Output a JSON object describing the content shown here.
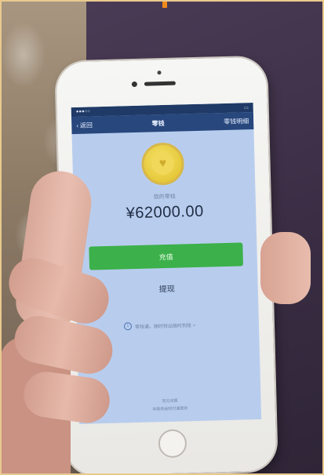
{
  "wallet_screen": {
    "nav": {
      "back_label": "返回",
      "title": "零钱",
      "right_label": "零钱明细"
    },
    "balance": {
      "label": "我的零钱",
      "amount": "¥62000.00"
    },
    "buttons": {
      "recharge_label": "充值",
      "withdraw_label": "提现"
    },
    "notice_text": "零钱通，随时转出随时到账 >",
    "footer_text": "常见问题",
    "footer_subtext": "本服务由财付通提供"
  },
  "colors": {
    "nav_bar": "#27477d",
    "screen_bg": "#b8cdee",
    "recharge_button": "#3cb04a",
    "coin": "#e6c83a",
    "accent_orange": "#f08a1c"
  }
}
